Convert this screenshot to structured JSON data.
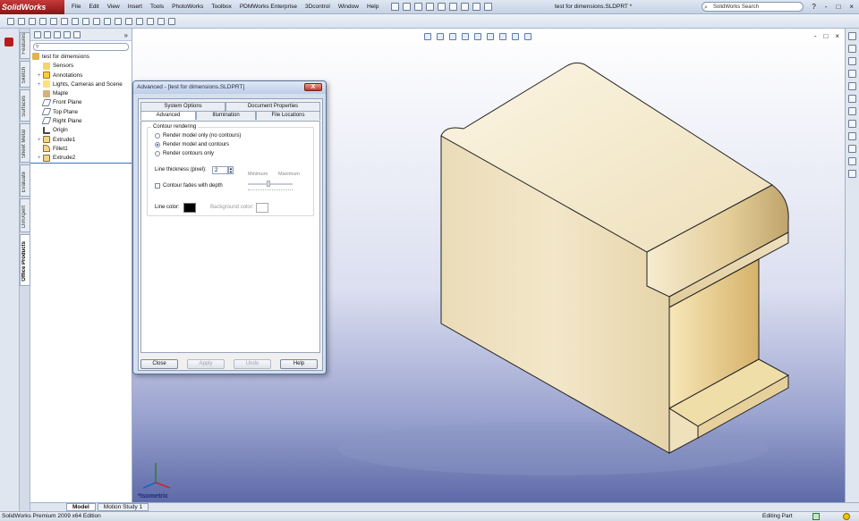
{
  "app": {
    "brand": "SolidWorks",
    "menu": [
      "File",
      "Edit",
      "View",
      "Insert",
      "Tools",
      "PhotoWorks",
      "Toolbox",
      "PDMWorks Enterprise",
      "3Dcontrol",
      "Window",
      "Help"
    ],
    "document_title": "test for dimensions.SLDPRT *",
    "search_placeholder": "SolidWorks Search",
    "window_buttons": [
      "?",
      "-",
      "□",
      "×"
    ]
  },
  "left_vertical_tabs": [
    "Features",
    "Sketch",
    "Surfaces",
    "Sheet Metal",
    "Evaluate",
    "DimXpert",
    "Office Products"
  ],
  "feature_tree": {
    "root": "test for dimensions",
    "items": [
      {
        "label": "Sensors",
        "expandable": false
      },
      {
        "label": "Annotations",
        "expandable": true
      },
      {
        "label": "Lights, Cameras and Scene",
        "expandable": true
      },
      {
        "label": "Maple",
        "expandable": false
      },
      {
        "label": "Front Plane",
        "expandable": false
      },
      {
        "label": "Top Plane",
        "expandable": false
      },
      {
        "label": "Right Plane",
        "expandable": false
      },
      {
        "label": "Origin",
        "expandable": false
      },
      {
        "label": "Extrude1",
        "expandable": true
      },
      {
        "label": "Fillet1",
        "expandable": false
      },
      {
        "label": "Extrude2",
        "expandable": true
      }
    ],
    "collapse_glyph": "»"
  },
  "viewport": {
    "view_label": "*Isometric",
    "window_buttons": [
      "-",
      "□",
      "×"
    ],
    "bg_top": "#ffffff",
    "bg_bottom": "#5e6aa8"
  },
  "dialog": {
    "title": "Advanced - [test for dimensions.SLDPRT]",
    "close_glyph": "X",
    "tabs_top": [
      "System Options",
      "Document Properties"
    ],
    "tabs_bottom": [
      "Advanced",
      "Illumination",
      "File Locations"
    ],
    "active_tab": "Advanced",
    "group_label": "Contour rendering",
    "radios": [
      {
        "label": "Render model only (no contours)",
        "checked": false
      },
      {
        "label": "Render model and contours",
        "checked": true
      },
      {
        "label": "Render contours only",
        "checked": false
      }
    ],
    "line_thickness_label": "Line thickness (pixel):",
    "line_thickness_value": "2",
    "contour_fades_label": "Contour fades with depth",
    "contour_fades_checked": false,
    "slider_min_label": "Minimum",
    "slider_max_label": "Maximum",
    "line_color_label": "Line color:",
    "line_color": "#000000",
    "background_color_label": "Background color:",
    "background_color": "#ffffff",
    "buttons": [
      {
        "label": "Close",
        "enabled": true
      },
      {
        "label": "Apply",
        "enabled": false
      },
      {
        "label": "Undo",
        "enabled": false
      },
      {
        "label": "Help",
        "enabled": true
      }
    ]
  },
  "bottom_tabs": [
    "Model",
    "Motion Study 1"
  ],
  "status": {
    "left": "SolidWorks Premium 2009 x64 Edition",
    "right": "Editing Part"
  },
  "colors": {
    "wood_light": "#f1e6c8",
    "wood_mid": "#e2cfa4",
    "wood_dark": "#c9b282",
    "brand_red": "#a82020"
  }
}
